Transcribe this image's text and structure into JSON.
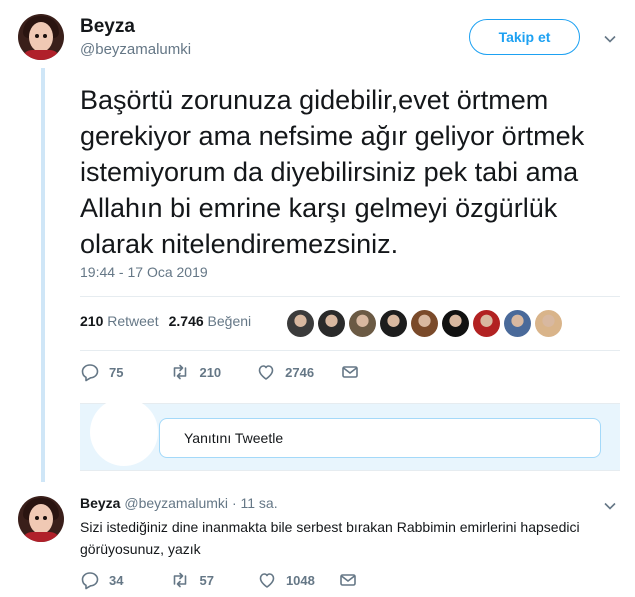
{
  "tweet": {
    "author_name": "Beyza",
    "author_handle": "@beyzamalumki",
    "follow_label": "Takip et",
    "text": "Başörtü zorunuza gidebilir,evet örtmem gerekiyor ama nefsime ağır geliyor örtmek istemiyorum da diyebilirsiniz pek tabi ama Allahın bi emrine karşı gelmeyi özgürlük olarak nitelendiremezsiniz.",
    "timestamp": "19:44 - 17 Oca 2019",
    "retweet_count": "210",
    "retweet_label": "Retweet",
    "like_count": "2.746",
    "like_label": "Beğeni",
    "liker_colors": [
      "#3b3b3b",
      "#2a2a2a",
      "#6b5a44",
      "#1d1d1d",
      "#7a4a2a",
      "#111111",
      "#b22222",
      "#4a6a9a",
      "#d9b48a"
    ],
    "actions": {
      "replies": "75",
      "retweets": "210",
      "likes": "2746"
    }
  },
  "reply_box": {
    "placeholder": "Yanıtını Tweetle"
  },
  "reply": {
    "author_name": "Beyza",
    "author_handle": "@beyzamalumki",
    "time": "· 11 sa.",
    "text": "Sizi istediğiniz dine inanmakta bile serbest bırakan Rabbimin emirlerini hapsedici görüyosunuz, yazık",
    "actions": {
      "replies": "34",
      "retweets": "57",
      "likes": "1048"
    }
  },
  "colors": {
    "accent": "#1da1f2",
    "muted": "#657786",
    "thread_line": "#cfe6f7"
  }
}
